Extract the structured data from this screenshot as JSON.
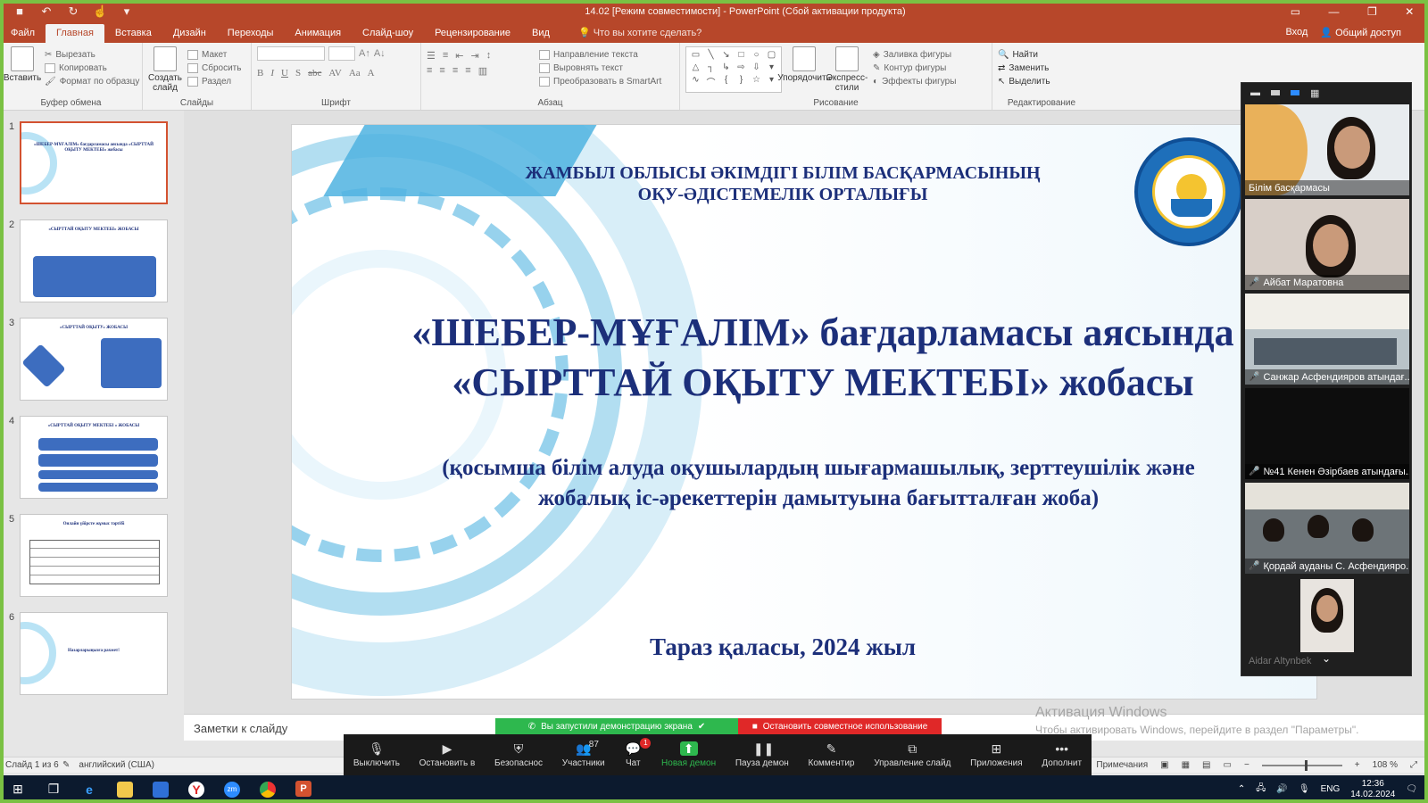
{
  "window": {
    "title": "14.02 [Режим совместимости] - PowerPoint (Сбой активации продукта)"
  },
  "tabs": [
    "Файл",
    "Главная",
    "Вставка",
    "Дизайн",
    "Переходы",
    "Анимация",
    "Слайд-шоу",
    "Рецензирование",
    "Вид"
  ],
  "tellme": "Что вы хотите сделать?",
  "account": {
    "signin": "Вход",
    "share": "Общий доступ"
  },
  "ribbon": {
    "clipboard": {
      "label": "Буфер обмена",
      "paste": "Вставить",
      "cut": "Вырезать",
      "copy": "Копировать",
      "format": "Формат по образцу"
    },
    "slides": {
      "label": "Слайды",
      "new": "Создать слайд",
      "layout": "Макет",
      "reset": "Сбросить",
      "section": "Раздел"
    },
    "font": {
      "label": "Шрифт"
    },
    "paragraph": {
      "label": "Абзац",
      "direction": "Направление текста",
      "align": "Выровнять текст",
      "smartart": "Преобразовать в SmartArt"
    },
    "drawing": {
      "label": "Рисование",
      "arrange": "Упорядочить",
      "styles": "Экспресс-стили",
      "fill": "Заливка фигуры",
      "outline": "Контур фигуры",
      "effects": "Эффекты фигуры"
    },
    "editing": {
      "label": "Редактирование",
      "find": "Найти",
      "replace": "Заменить",
      "select": "Выделить"
    }
  },
  "thumbnails": [
    {
      "num": "1",
      "text": "«ШЕБЕР-МҰҒАЛІМ» бағдарламасы аясында «СЫРТТАЙ ОҚЫТУ МЕКТЕБІ» жобасы"
    },
    {
      "num": "2",
      "text": "«СЫРТТАЙ ОҚЫТУ МЕКТЕБІ» ЖОБАСЫ"
    },
    {
      "num": "3",
      "text": "«СЫРТТАЙ ОҚЫТУ» ЖОБАСЫ"
    },
    {
      "num": "4",
      "text": "«СЫРТТАЙ ОҚЫТУ МЕКТЕБІ » ЖОБАСЫ"
    },
    {
      "num": "5",
      "text": "Онлайн үйірсте жұмыс тәртібі"
    },
    {
      "num": "6",
      "text": "Назарларыңызға рахмет!"
    }
  ],
  "slide": {
    "org_line1": "ЖАМБЫЛ ОБЛЫСЫ ӘКІМДІГІ БІЛІМ БАСҚАРМАСЫНЫҢ",
    "org_line2": "ОҚУ-ӘДІСТЕМЕЛІК ОРТАЛЫҒЫ",
    "title_line1": "«ШЕБЕР-МҰҒАЛІМ» бағдарламасы аясында",
    "title_line2": "«СЫРТТАЙ ОҚЫТУ МЕКТЕБІ» жобасы",
    "subtitle_line1": "(қосымша білім алуда оқушылардың шығармашылық, зерттеушілік және",
    "subtitle_line2": "жобалық іс-әрекеттерін дамытуына бағытталған жоба)",
    "city": "Тараз қаласы, 2024 жыл"
  },
  "notes_placeholder": "Заметки к слайду",
  "activation": {
    "title": "Активация Windows",
    "text": "Чтобы активировать Windows, перейдите в раздел \"Параметры\"."
  },
  "statusbar": {
    "slide": "Слайд 1 из 6",
    "language": "английский (США)",
    "notes": "Примечания",
    "zoom": "108 %"
  },
  "zoom": {
    "banner_share": "Вы запустили демонстрацию экрана",
    "banner_stop": "Остановить совместное использование",
    "participants_count": "87",
    "chat_badge": "1",
    "buttons": [
      "Выключить",
      "Остановить в",
      "Безопаснос",
      "Участники",
      "Чат",
      "Новая демон",
      "Пауза демон",
      "Комментир",
      "Управление слайд",
      "Приложения",
      "Дополнит"
    ],
    "tiles": [
      {
        "name": "Білім басқармасы"
      },
      {
        "name": "Айбат Маратовна"
      },
      {
        "name": "Санжар Асфендияров атындағ..."
      },
      {
        "name": "№41 Кенен Әзірбаев атындағы..."
      },
      {
        "name": "Қордай ауданы С. Асфендияро..."
      },
      {
        "name": "Aidar Altynbek"
      }
    ]
  },
  "taskbar": {
    "lang": "ENG",
    "time": "12:36",
    "date": "14.02.2024"
  },
  "colors": {
    "powerpoint_red": "#b7472a",
    "slide_navy": "#1c2f7a",
    "zoom_green": "#2eb84e",
    "zoom_red": "#e02828"
  }
}
